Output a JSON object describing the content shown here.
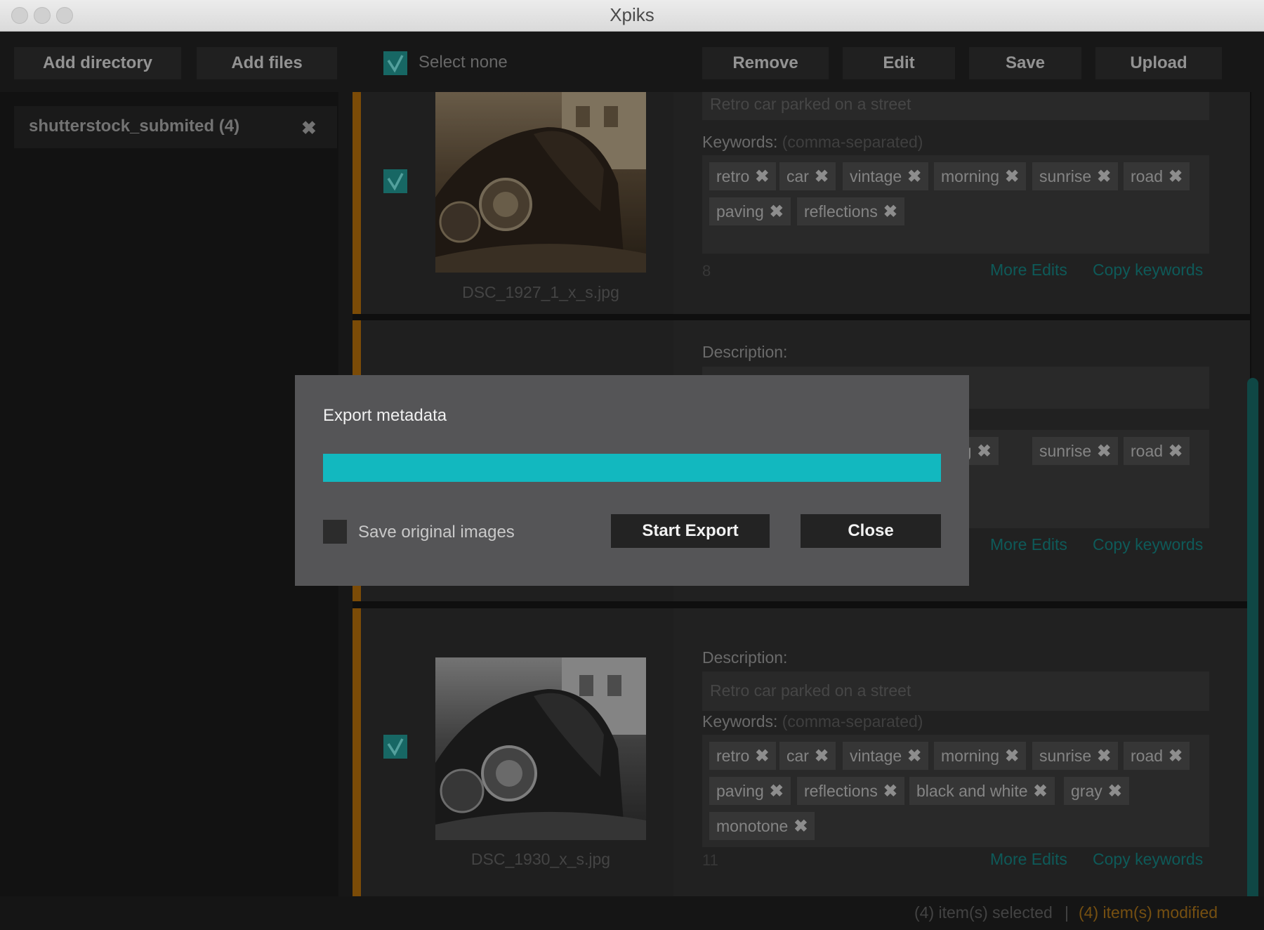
{
  "window": {
    "title": "Xpiks"
  },
  "toolbar": {
    "add_directory": "Add directory",
    "add_files": "Add files",
    "select_none": "Select none",
    "remove": "Remove",
    "edit": "Edit",
    "save": "Save",
    "upload": "Upload"
  },
  "sidebar": {
    "directory": {
      "label": "shutterstock_submited (4)",
      "close": "✖"
    }
  },
  "items": [
    {
      "filename": "DSC_1927_1_x_s.jpg",
      "description": "Retro car parked on a street",
      "keywords_label": "Keywords:",
      "keywords_hint": "(comma-separated)",
      "keywords": [
        "retro",
        "car",
        "vintage",
        "morning",
        "sunrise",
        "road",
        "paving",
        "reflections"
      ],
      "keyword_count": "8",
      "more_edits": "More Edits",
      "copy_keywords": "Copy keywords"
    },
    {
      "description_label": "Description:",
      "keywords_visible": [
        "ning",
        "sunrise",
        "road"
      ],
      "more_edits": "More Edits",
      "copy_keywords": "Copy keywords"
    },
    {
      "filename": "DSC_1930_x_s.jpg",
      "description_label": "Description:",
      "description": "Retro car parked on a street",
      "keywords_label": "Keywords:",
      "keywords_hint": "(comma-separated)",
      "keywords": [
        "retro",
        "car",
        "vintage",
        "morning",
        "sunrise",
        "road",
        "paving",
        "reflections",
        "black and white",
        "gray",
        "monotone"
      ],
      "keyword_count": "11",
      "more_edits": "More Edits",
      "copy_keywords": "Copy keywords"
    }
  ],
  "status": {
    "selected": "(4) item(s) selected",
    "divider": "|",
    "modified": "(4) item(s) modified"
  },
  "dialog": {
    "title": "Export metadata",
    "progress_fraction": 1.0,
    "save_original_label": "Save original images",
    "start_export": "Start Export",
    "close": "Close"
  },
  "colors": {
    "accent": "#12b8bf",
    "item_stripe": "#a4650a",
    "link": "#137977",
    "modified": "#9c6a17"
  }
}
